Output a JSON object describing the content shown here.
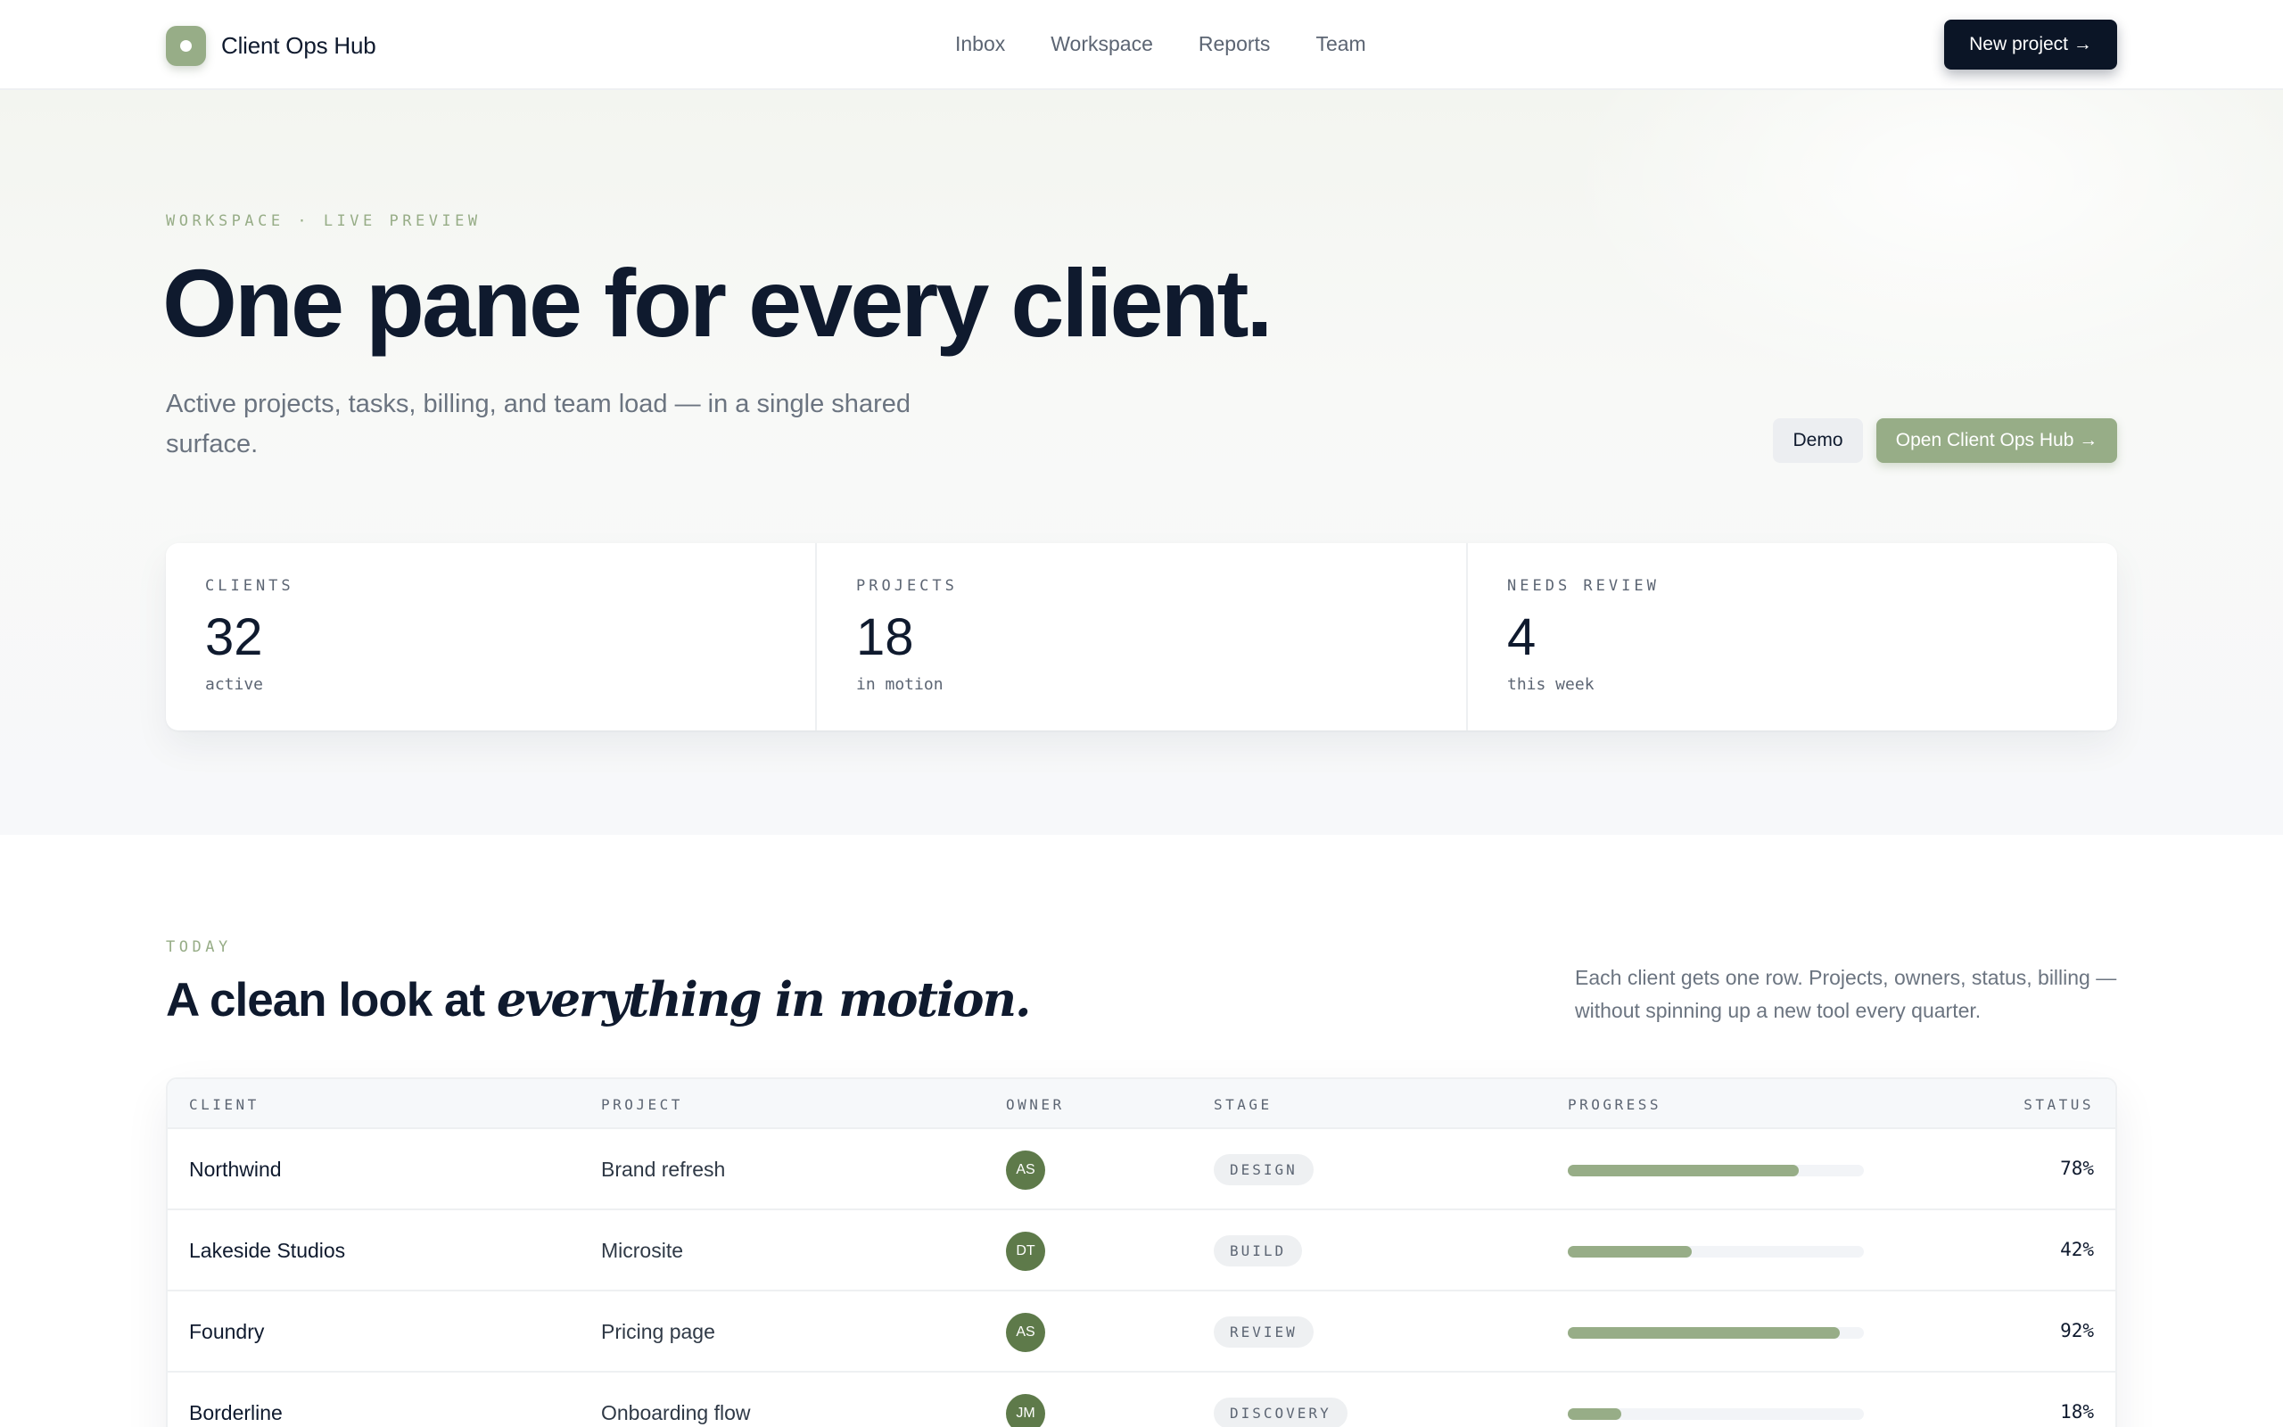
{
  "nav": {
    "brand": "Client Ops Hub",
    "links": [
      "Inbox",
      "Workspace",
      "Reports",
      "Team"
    ],
    "cta": "New project →"
  },
  "hero": {
    "eyebrow": "WORKSPACE · LIVE PREVIEW",
    "title": "One pane for every client.",
    "subtitle": "Active projects, tasks, billing, and team load — in a single shared surface.",
    "demo_button": "Demo",
    "open_button": "Open Client Ops Hub →"
  },
  "stats": [
    {
      "label": "CLIENTS",
      "value": "32",
      "sub": "active"
    },
    {
      "label": "PROJECTS",
      "value": "18",
      "sub": "in motion"
    },
    {
      "label": "NEEDS REVIEW",
      "value": "4",
      "sub": "this week"
    }
  ],
  "section": {
    "eyebrow": "TODAY",
    "title_plain": "A clean look at ",
    "title_italic": "everything in motion.",
    "description": "Each client gets one row. Projects, owners, status, billing — without spinning up a new tool every quarter."
  },
  "table": {
    "headers": {
      "client": "CLIENT",
      "project": "PROJECT",
      "owner": "OWNER",
      "stage": "STAGE",
      "progress": "PROGRESS",
      "status": "STATUS"
    },
    "rows": [
      {
        "client": "Northwind",
        "project": "Brand refresh",
        "owner": "AS",
        "stage": "DESIGN",
        "progress": 78,
        "status": "78%"
      },
      {
        "client": "Lakeside Studios",
        "project": "Microsite",
        "owner": "DT",
        "stage": "BUILD",
        "progress": 42,
        "status": "42%"
      },
      {
        "client": "Foundry",
        "project": "Pricing page",
        "owner": "AS",
        "stage": "REVIEW",
        "progress": 92,
        "status": "92%"
      },
      {
        "client": "Borderline",
        "project": "Onboarding flow",
        "owner": "JM",
        "stage": "DISCOVERY",
        "progress": 18,
        "status": "18%"
      }
    ]
  },
  "colors": {
    "accent": "#97ad87",
    "ink": "#0f1a2e",
    "owner_avatar": "#5e7a4a"
  }
}
